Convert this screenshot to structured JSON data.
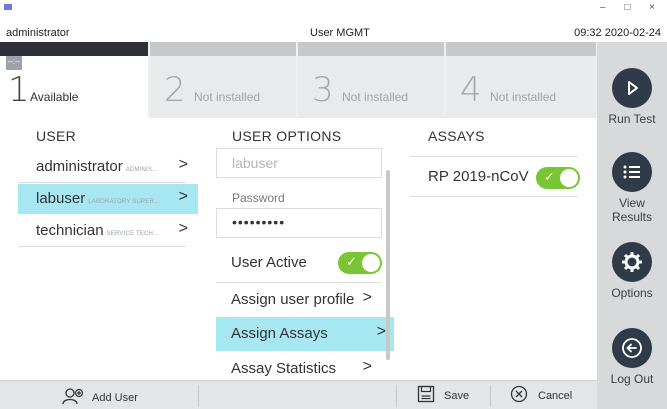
{
  "titlebar": {
    "user": "administrator",
    "title": "User MGMT",
    "datetime": "09:32 2020-02-24",
    "controls": "– □ ×"
  },
  "modules": [
    {
      "number": "1",
      "label": "Available",
      "flag": "--:--"
    },
    {
      "number": "2",
      "label": "Not installed"
    },
    {
      "number": "3",
      "label": "Not installed"
    },
    {
      "number": "4",
      "label": "Not installed"
    }
  ],
  "sidebar": {
    "run_test": "Run Test",
    "view_results_1": "View",
    "view_results_2": "Results",
    "options": "Options",
    "log_out": "Log Out"
  },
  "users": {
    "header": "USER",
    "items": [
      {
        "name": "administrator",
        "role": "ADMINIS...",
        "selected": false
      },
      {
        "name": "labuser",
        "role": "LABORATORY SUPER...",
        "selected": true
      },
      {
        "name": "technician",
        "role": "SERVICE TECH...",
        "selected": false
      }
    ]
  },
  "user_options": {
    "header": "USER OPTIONS",
    "username_value": "labuser",
    "password_label": "Password",
    "password_value": "•••••••••",
    "user_active_label": "User Active",
    "user_active": true,
    "assign_profile": "Assign user profile",
    "assign_assays": "Assign Assays",
    "assay_statistics": "Assay Statistics"
  },
  "assays": {
    "header": "ASSAYS",
    "items": [
      {
        "name": "RP 2019-nCoV",
        "enabled": true
      }
    ]
  },
  "bottom": {
    "add_user": "Add User",
    "save": "Save",
    "cancel": "Cancel"
  },
  "colors": {
    "accent_selection": "#a6e7f2",
    "toggle_on": "#79c534",
    "sidebar_icon": "#2f3b49"
  },
  "icons": {
    "run_test": "play-icon",
    "view_results": "list-icon",
    "options": "gear-icon",
    "log_out": "logout-icon",
    "add_user": "add-user-icon",
    "save": "save-icon",
    "cancel": "cancel-icon"
  }
}
